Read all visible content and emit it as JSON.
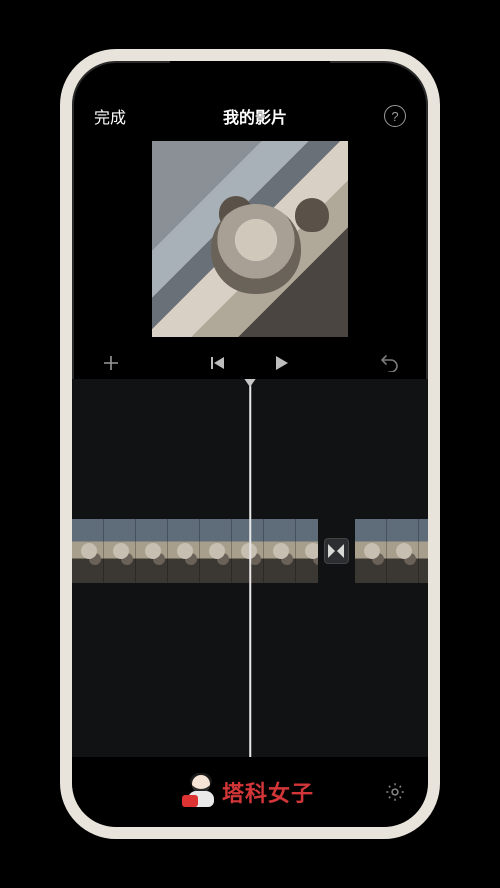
{
  "header": {
    "done_label": "完成",
    "title": "我的影片",
    "help_label": "?"
  },
  "controls": {
    "add_icon": "plus-icon",
    "prev_icon": "skip-back-icon",
    "play_icon": "play-icon",
    "undo_icon": "undo-icon"
  },
  "timeline": {
    "clips": [
      {
        "id": "clip-1",
        "thumbs": 8
      },
      {
        "id": "clip-2",
        "thumbs": 3
      }
    ],
    "transition_icon": "transition-icon"
  },
  "footer": {
    "watermark_text": "塔科女子",
    "settings_icon": "gear-icon"
  }
}
